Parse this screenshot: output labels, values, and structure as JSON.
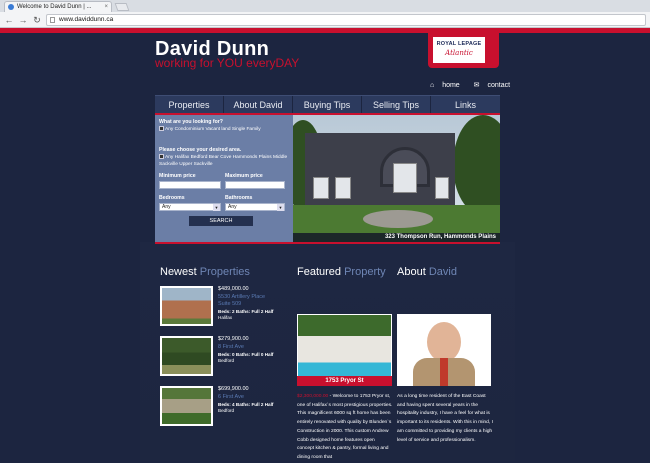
{
  "browser": {
    "tab_title": "Welcome to David Dunn | ...",
    "url": "www.daviddunn.ca"
  },
  "header": {
    "name": "David Dunn",
    "tagline": "working for YOU everyDAY",
    "logo_line1": "ROYAL LEPAGE",
    "logo_line2": "Atlantic",
    "home_link": "home",
    "contact_link": "contact"
  },
  "nav": {
    "items": [
      {
        "label": "Properties"
      },
      {
        "label": "About David"
      },
      {
        "label": "Buying Tips"
      },
      {
        "label": "Selling Tips"
      },
      {
        "label": "Links"
      }
    ]
  },
  "search": {
    "q1": "What are you looking for?",
    "types": "Any   Condominium   Vacant land   Single Family",
    "q2": "Please choose your desired area.",
    "areas": "Any   Halifax   Bedford   Bear Cove   Hammonds Plains   Middle Sackville   Upper Sackville",
    "min_price_label": "Minimum price",
    "max_price_label": "Maximum price",
    "bedrooms_label": "Bedrooms",
    "bathrooms_label": "Bathrooms",
    "bedrooms_value": "Any",
    "bathrooms_value": "Any",
    "button": "SEARCH"
  },
  "hero": {
    "caption": "323 Thompson Run, Hammonds Plains"
  },
  "newest": {
    "title_a": "Newest",
    "title_b": "Properties",
    "listings": [
      {
        "price": "$489,000.00",
        "addr1": "5530 Artillery Place",
        "addr2": "Suite 509",
        "meta1": "Beds: 2 Baths: Full 2 Half",
        "meta2": "Halifax"
      },
      {
        "price": "$279,900.00",
        "addr1": "8 First Ave",
        "addr2": "",
        "meta1": "Beds: 0 Baths: Full 0 Half",
        "meta2": "Bedford"
      },
      {
        "price": "$699,900.00",
        "addr1": "6 First Ave",
        "addr2": "",
        "meta1": "Beds: 4 Baths: Full 2 Half",
        "meta2": "Bedford"
      }
    ]
  },
  "featured": {
    "title_a": "Featured",
    "title_b": "Property",
    "caption": "1753 Pryor St",
    "price": "$2,300,000.00",
    "text": " -  Welcome to 1753 Pryor st, one of Halifax`s most prestigious properties. This magnificent 6000 sq ft home has been entirely renovated with quality by Blunden`s Construction in 2000. This custom Andrew Cobb designed home features open concept kitchen & pantry, formal living and dining room that"
  },
  "about": {
    "title_a": "About",
    "title_b": "David",
    "text": "As a long time resident of the East Coast and having spent several years in the hospitality industry, I have a feel for what is important to its residents. With this in mind, I am committed to providing my clients a high level of service and professionalism."
  },
  "colors": {
    "brand_red": "#c8102e",
    "navy": "#1c2540",
    "panel": "#6b7ea6",
    "accent_blue": "#6f86b5"
  }
}
